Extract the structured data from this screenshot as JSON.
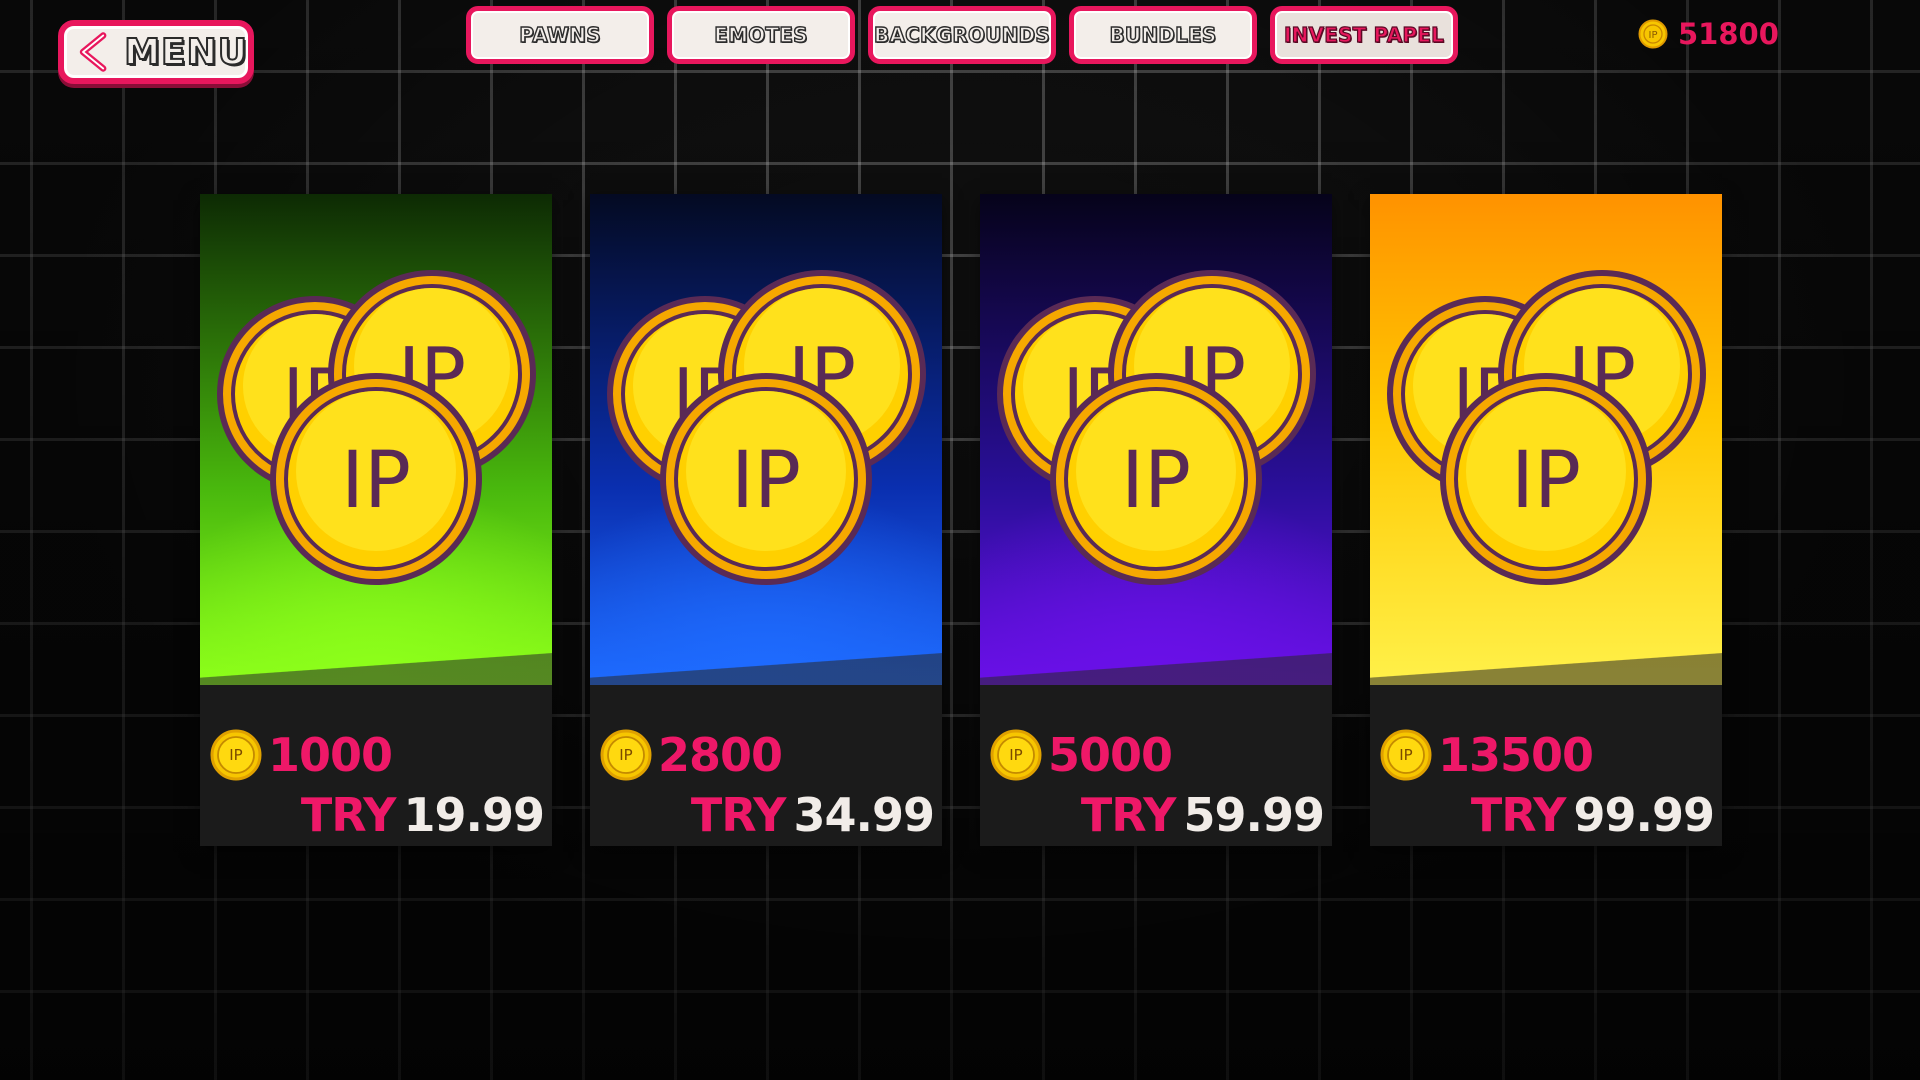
{
  "colors": {
    "accent": "#e8175d",
    "button_bg": "#f3eeea",
    "coin_gold": "#f7c600",
    "coin_outline": "#5a2a55"
  },
  "menu": {
    "label": "MENU",
    "icon": "chevron-left-icon"
  },
  "tabs": [
    {
      "label": "PAWNS",
      "active": false
    },
    {
      "label": "EMOTES",
      "active": false
    },
    {
      "label": "BACKGROUNDS",
      "active": false
    },
    {
      "label": "BUNDLES",
      "active": false
    },
    {
      "label": "INVEST PAPEL",
      "active": true
    }
  ],
  "balance": {
    "icon": "ip-coin-icon",
    "value": "51800"
  },
  "coin_text": "IP",
  "packs": [
    {
      "theme": "green",
      "colors": [
        "#0d2a04",
        "#49b80d",
        "#8dff1a"
      ],
      "amount": "1000",
      "currency": "TRY",
      "price": "19.99"
    },
    {
      "theme": "blue",
      "colors": [
        "#040a22",
        "#0a2fb0",
        "#1e6bff"
      ],
      "amount": "2800",
      "currency": "TRY",
      "price": "34.99"
    },
    {
      "theme": "purple",
      "colors": [
        "#06031a",
        "#2a0f9a",
        "#6a10e8"
      ],
      "amount": "5000",
      "currency": "TRY",
      "price": "59.99"
    },
    {
      "theme": "yellow",
      "colors": [
        "#ff9200",
        "#ffc800",
        "#fff14a"
      ],
      "amount": "13500",
      "currency": "TRY",
      "price": "99.99"
    }
  ]
}
